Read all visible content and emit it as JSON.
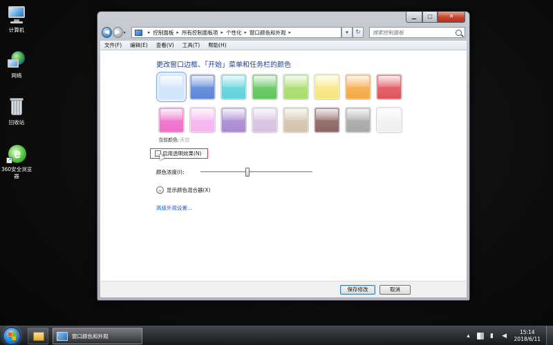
{
  "desktop": {
    "icons": [
      {
        "label": "计算机",
        "icon": "computer-icon"
      },
      {
        "label": "网络",
        "icon": "network-icon"
      },
      {
        "label": "回收站",
        "icon": "recycle-bin-icon"
      },
      {
        "label": "360安全浏览器",
        "icon": "browser-360-icon"
      }
    ]
  },
  "window": {
    "nav": {
      "breadcrumb": [
        "控制面板",
        "所有控制面板项",
        "个性化",
        "窗口颜色和外观"
      ],
      "search_placeholder": "搜索控制面板"
    },
    "menu": [
      "文件(F)",
      "编辑(E)",
      "查看(V)",
      "工具(T)",
      "帮助(H)"
    ],
    "heading": "更改窗口边框、「开始」菜单和任务栏的颜色",
    "swatches": [
      {
        "name": "sky",
        "color": "#cfe4fb",
        "selected": true
      },
      {
        "name": "twilight",
        "color": "#5b86d6"
      },
      {
        "name": "sea",
        "color": "#5fd3dc"
      },
      {
        "name": "leaf",
        "color": "#61c45c"
      },
      {
        "name": "lime",
        "color": "#a7dc6a"
      },
      {
        "name": "lemon",
        "color": "#f6e67e"
      },
      {
        "name": "pumpkin",
        "color": "#f6a945"
      },
      {
        "name": "ruby",
        "color": "#e0535b"
      },
      {
        "name": "fuchsia",
        "color": "#ee6fca"
      },
      {
        "name": "blush",
        "color": "#f4b5ee"
      },
      {
        "name": "violet",
        "color": "#a98ad2"
      },
      {
        "name": "lavender",
        "color": "#d6c1e2"
      },
      {
        "name": "taupe",
        "color": "#d3c3aa"
      },
      {
        "name": "chocolate",
        "color": "#8c6563"
      },
      {
        "name": "slate",
        "color": "#a8a8a8"
      },
      {
        "name": "frost",
        "color": "#f0f0f0"
      }
    ],
    "current_color_label": "当前颜色:",
    "current_color_value": "天空",
    "transparency_label": "启用透明效果(N)",
    "transparency_checked": false,
    "intensity_label": "颜色浓度(I):",
    "intensity_fraction": 0.42,
    "mixer_label": "显示颜色混合器(X)",
    "advanced_link": "高级外观设置...",
    "save_button": "保存修改",
    "cancel_button": "取消"
  },
  "taskbar": {
    "active_task": "窗口颜色和外观",
    "time": "15:14",
    "date": "2018/6/11"
  }
}
